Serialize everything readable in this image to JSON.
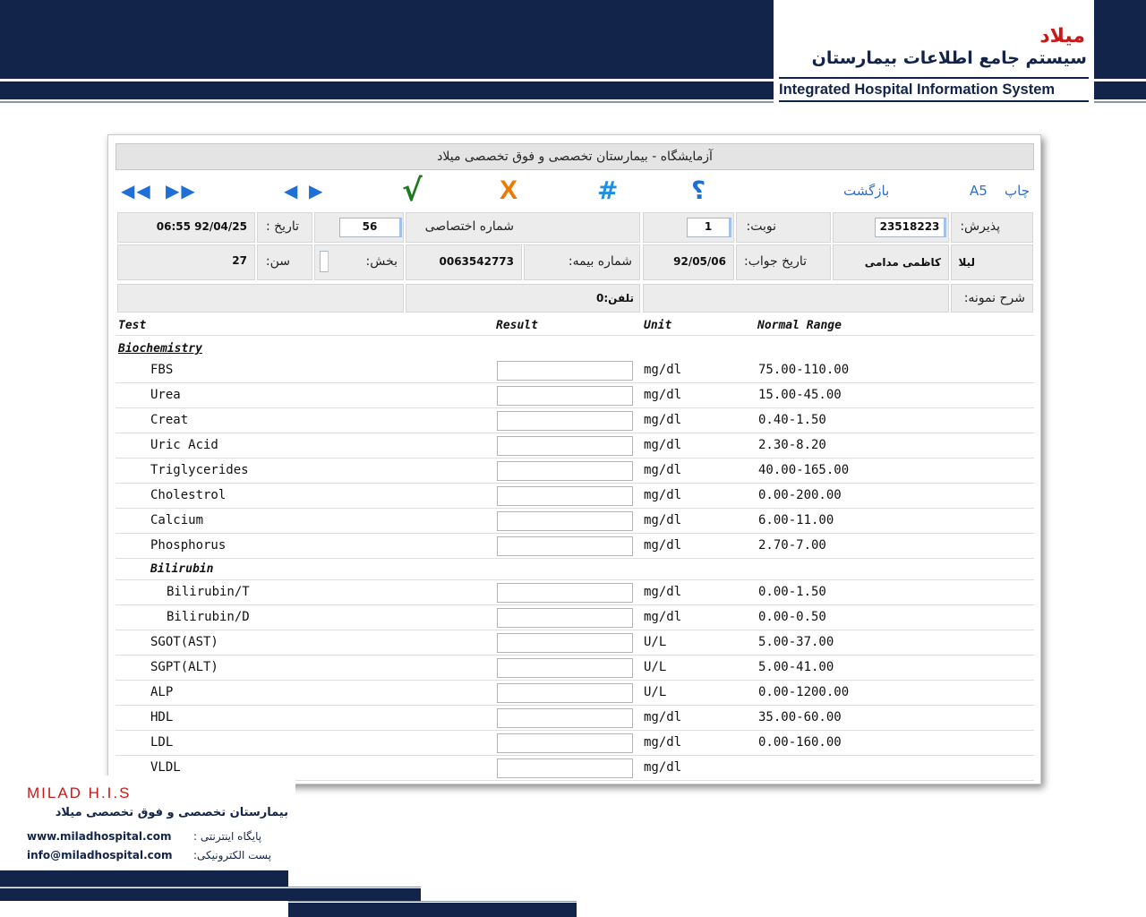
{
  "banner": {
    "logo_brand": "میلاد",
    "logo_title": "سیستم جامع اطلاعات بیمارستان",
    "logo_english": "Integrated Hospital Information System"
  },
  "window": {
    "title": "آزمایشگاه - بیمارستان تخصصی و فوق تخصصی میلاد"
  },
  "toolbar": {
    "nav_first_prev": "◀◀",
    "nav_next_last": "▶▶",
    "nav_prev": "◀",
    "nav_next": "▶",
    "confirm_label": "√",
    "cancel_label": "X",
    "number_label": "#",
    "help_label": "؟",
    "back_label": "بازگشت",
    "a5_label": "A5",
    "print_label": "چاپ"
  },
  "form": {
    "admission_label": "پذیرش:",
    "admission_value": "23518223",
    "turn_label": "نوبت:",
    "turn_value": "1",
    "special_number_label": "شماره اختصاصی",
    "special_number_value": "56",
    "date_label": "تاریخ :",
    "date_value": "06:55 92/04/25",
    "patient_first_name": "لیلا",
    "patient_last_name": "کاظمی مدامی",
    "answer_date_label": "تاریخ جواب:",
    "answer_date_value": "92/05/06",
    "insurance_label": "شماره بیمه:",
    "insurance_value": "0063542773",
    "ward_label": "بخش:",
    "ward_value": "",
    "age_label": "سن:",
    "age_value": "27",
    "sample_desc_label": "شرح نمونه:",
    "phone_text": "تلفن:0"
  },
  "table": {
    "headers": {
      "test": "Test",
      "result": "Result",
      "unit": "Unit",
      "range": "Normal Range"
    },
    "section_biochemistry": "Biochemistry",
    "subsection_bilirubin": "Bilirubin",
    "rows": [
      {
        "name": "FBS",
        "unit": "mg/dl",
        "range": "75.00-110.00"
      },
      {
        "name": "Urea",
        "unit": "mg/dl",
        "range": "15.00-45.00"
      },
      {
        "name": "Creat",
        "unit": "mg/dl",
        "range": "0.40-1.50"
      },
      {
        "name": "Uric Acid",
        "unit": "mg/dl",
        "range": "2.30-8.20"
      },
      {
        "name": "Triglycerides",
        "unit": "mg/dl",
        "range": "40.00-165.00"
      },
      {
        "name": "Cholestrol",
        "unit": "mg/dl",
        "range": "0.00-200.00"
      },
      {
        "name": "Calcium",
        "unit": "mg/dl",
        "range": "6.00-11.00"
      },
      {
        "name": "Phosphorus",
        "unit": "mg/dl",
        "range": "2.70-7.00"
      }
    ],
    "bilirubin_rows": [
      {
        "name": "Bilirubin/T",
        "unit": "mg/dl",
        "range": "0.00-1.50"
      },
      {
        "name": "Bilirubin/D",
        "unit": "mg/dl",
        "range": "0.00-0.50"
      }
    ],
    "rows2": [
      {
        "name": "SGOT(AST)",
        "unit": "U/L",
        "range": "5.00-37.00"
      },
      {
        "name": "SGPT(ALT)",
        "unit": "U/L",
        "range": "5.00-41.00"
      },
      {
        "name": "ALP",
        "unit": "U/L",
        "range": "0.00-1200.00"
      },
      {
        "name": "HDL",
        "unit": "mg/dl",
        "range": "35.00-60.00"
      },
      {
        "name": "LDL",
        "unit": "mg/dl",
        "range": "0.00-160.00"
      },
      {
        "name": "VLDL",
        "unit": "mg/dl",
        "range": ""
      }
    ]
  },
  "footer": {
    "brand": "MILAD H.I.S",
    "hospital": "بیمارستان تخصصی و فوق تخصصی میلاد",
    "website_label": "پایگاه اینترنتی :",
    "website": "www.miladhospital.com",
    "email_label": "پست الکترونیکی:",
    "email": "info@miladhospital.com"
  }
}
